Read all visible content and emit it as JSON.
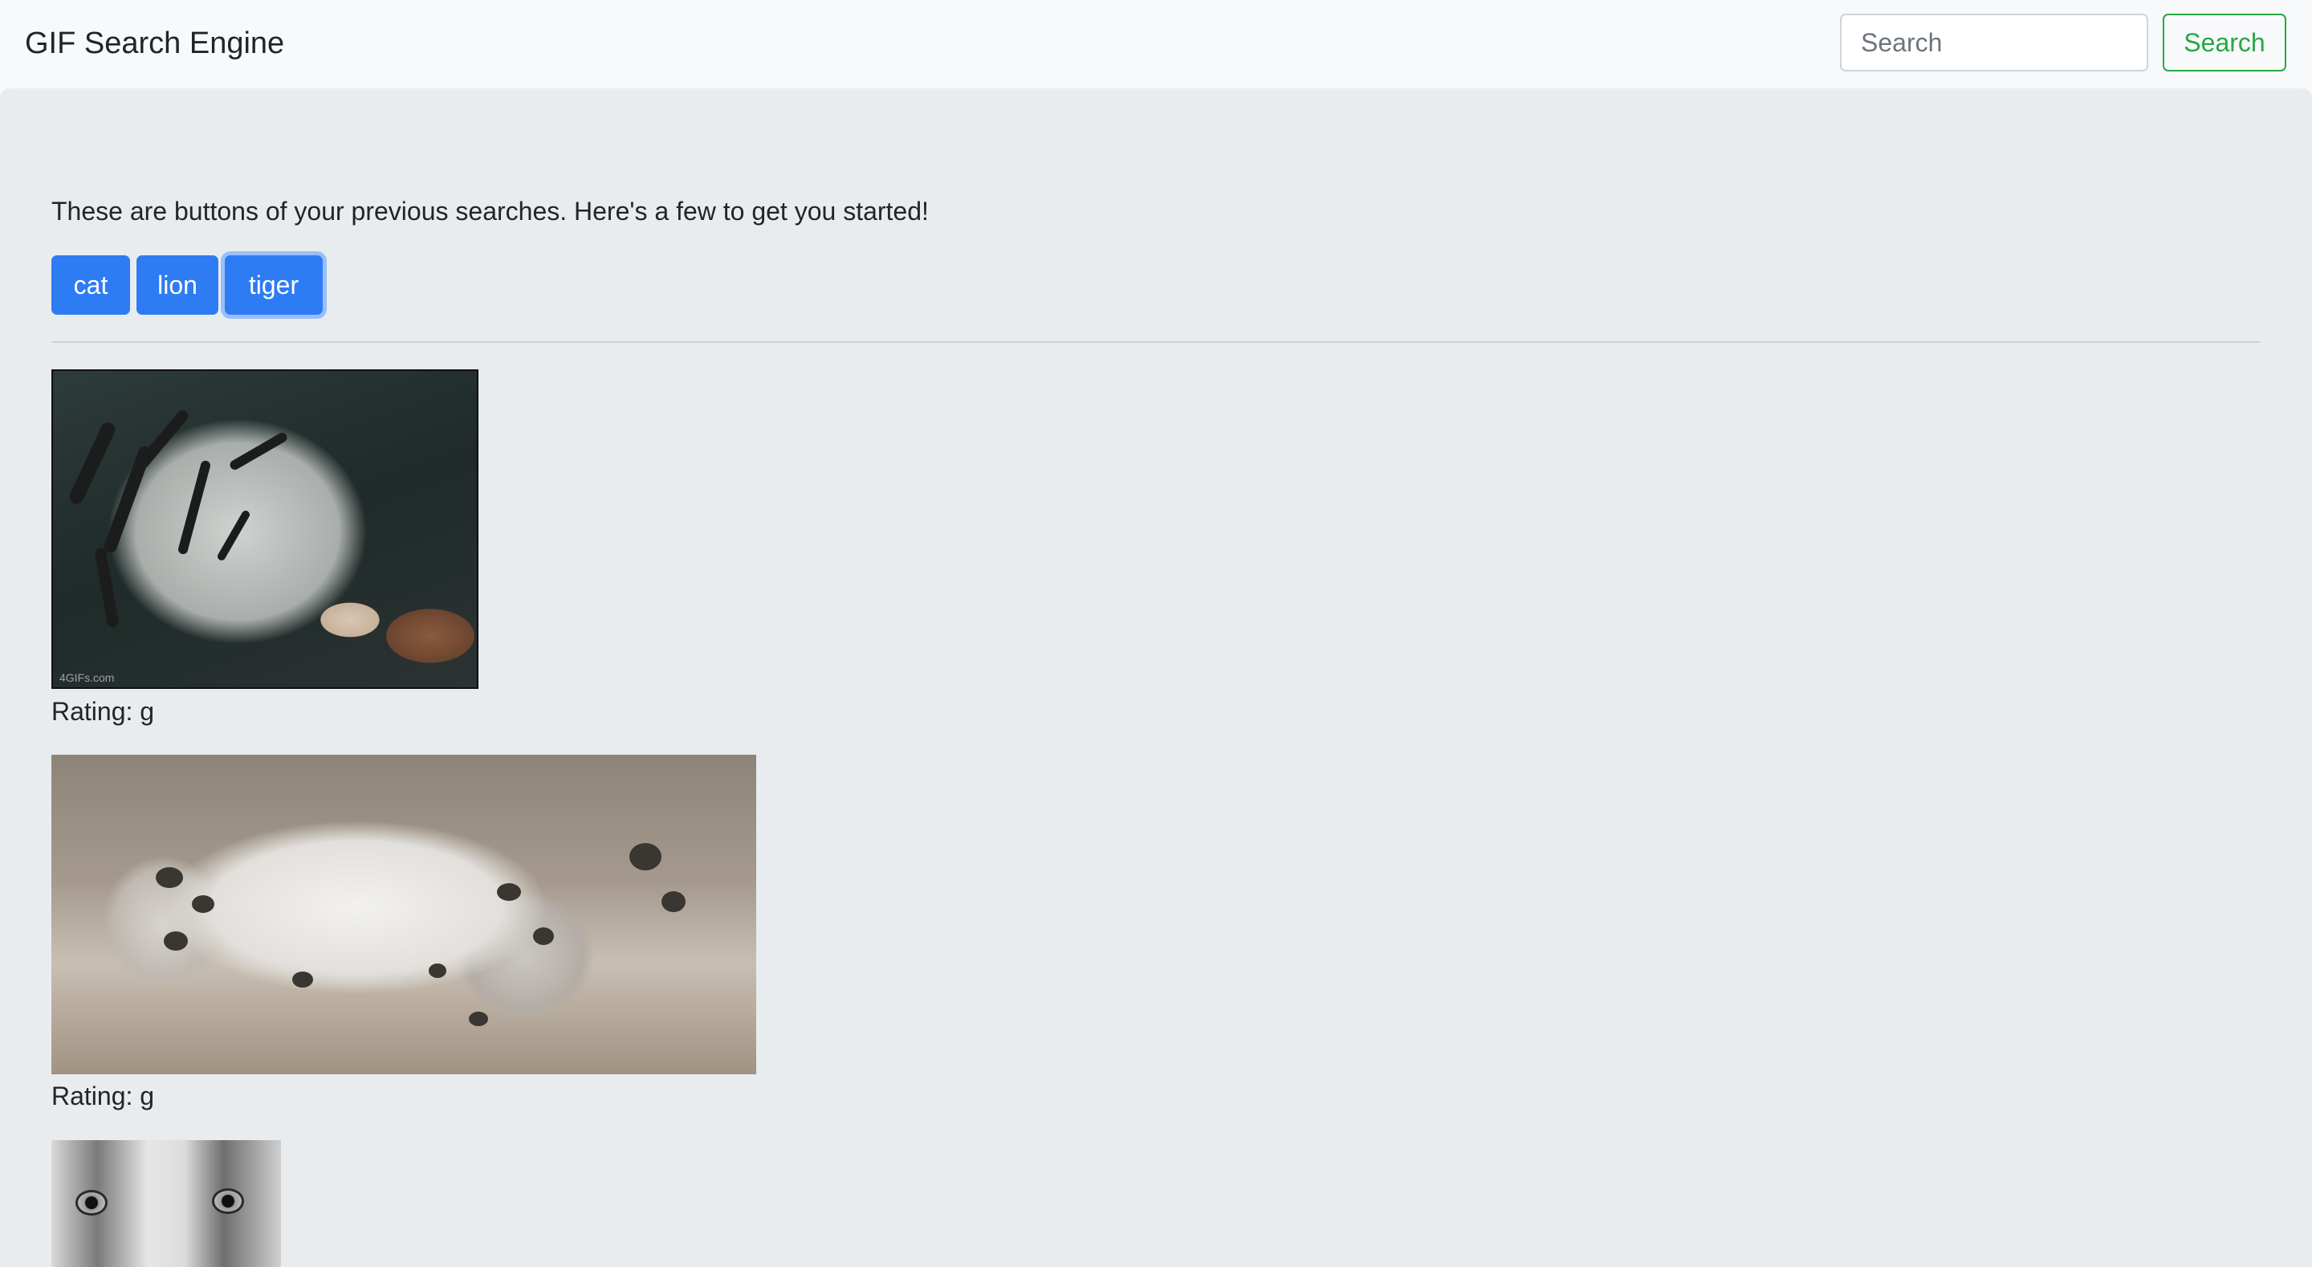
{
  "navbar": {
    "brand": "GIF Search Engine",
    "search_placeholder": "Search",
    "search_button": "Search"
  },
  "main": {
    "intro": "These are buttons of your previous searches. Here's a few to get you started!",
    "topic_buttons": [
      "cat",
      "lion",
      "tiger"
    ],
    "gifs": [
      {
        "rating": "Rating: g",
        "watermark": "4GIFs.com"
      },
      {
        "rating": "Rating: g"
      },
      {
        "rating": ""
      }
    ]
  },
  "colors": {
    "primary": "#2d7cf4",
    "success": "#28a745",
    "navbar_bg": "#f8f9fa",
    "jumbotron_bg": "#e9ecef"
  }
}
